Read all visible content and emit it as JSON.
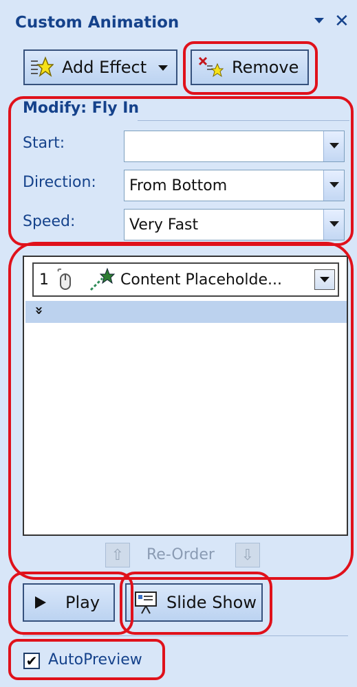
{
  "pane": {
    "title": "Custom Animation",
    "close_glyph": "✕"
  },
  "toolbar": {
    "add_effect_label": "Add Effect",
    "remove_label": "Remove"
  },
  "modify": {
    "title": "Modify: Fly In",
    "start_label": "Start:",
    "start_value": "",
    "direction_label": "Direction:",
    "direction_value": "From Bottom",
    "speed_label": "Speed:",
    "speed_value": "Very Fast"
  },
  "animation_list": {
    "items": [
      {
        "number": "1",
        "text": "Content Placeholde..."
      }
    ],
    "expand_glyph": "»"
  },
  "reorder": {
    "label": "Re-Order",
    "up_glyph": "⇧",
    "down_glyph": "⇩"
  },
  "playback": {
    "play_label": "Play",
    "slideshow_label": "Slide Show"
  },
  "autopreview": {
    "label": "AutoPreview",
    "checked": true,
    "check_glyph": "✔"
  },
  "colors": {
    "accent": "#15428b",
    "highlight": "#e0111b",
    "panel_bg": "#d8e6f8"
  }
}
